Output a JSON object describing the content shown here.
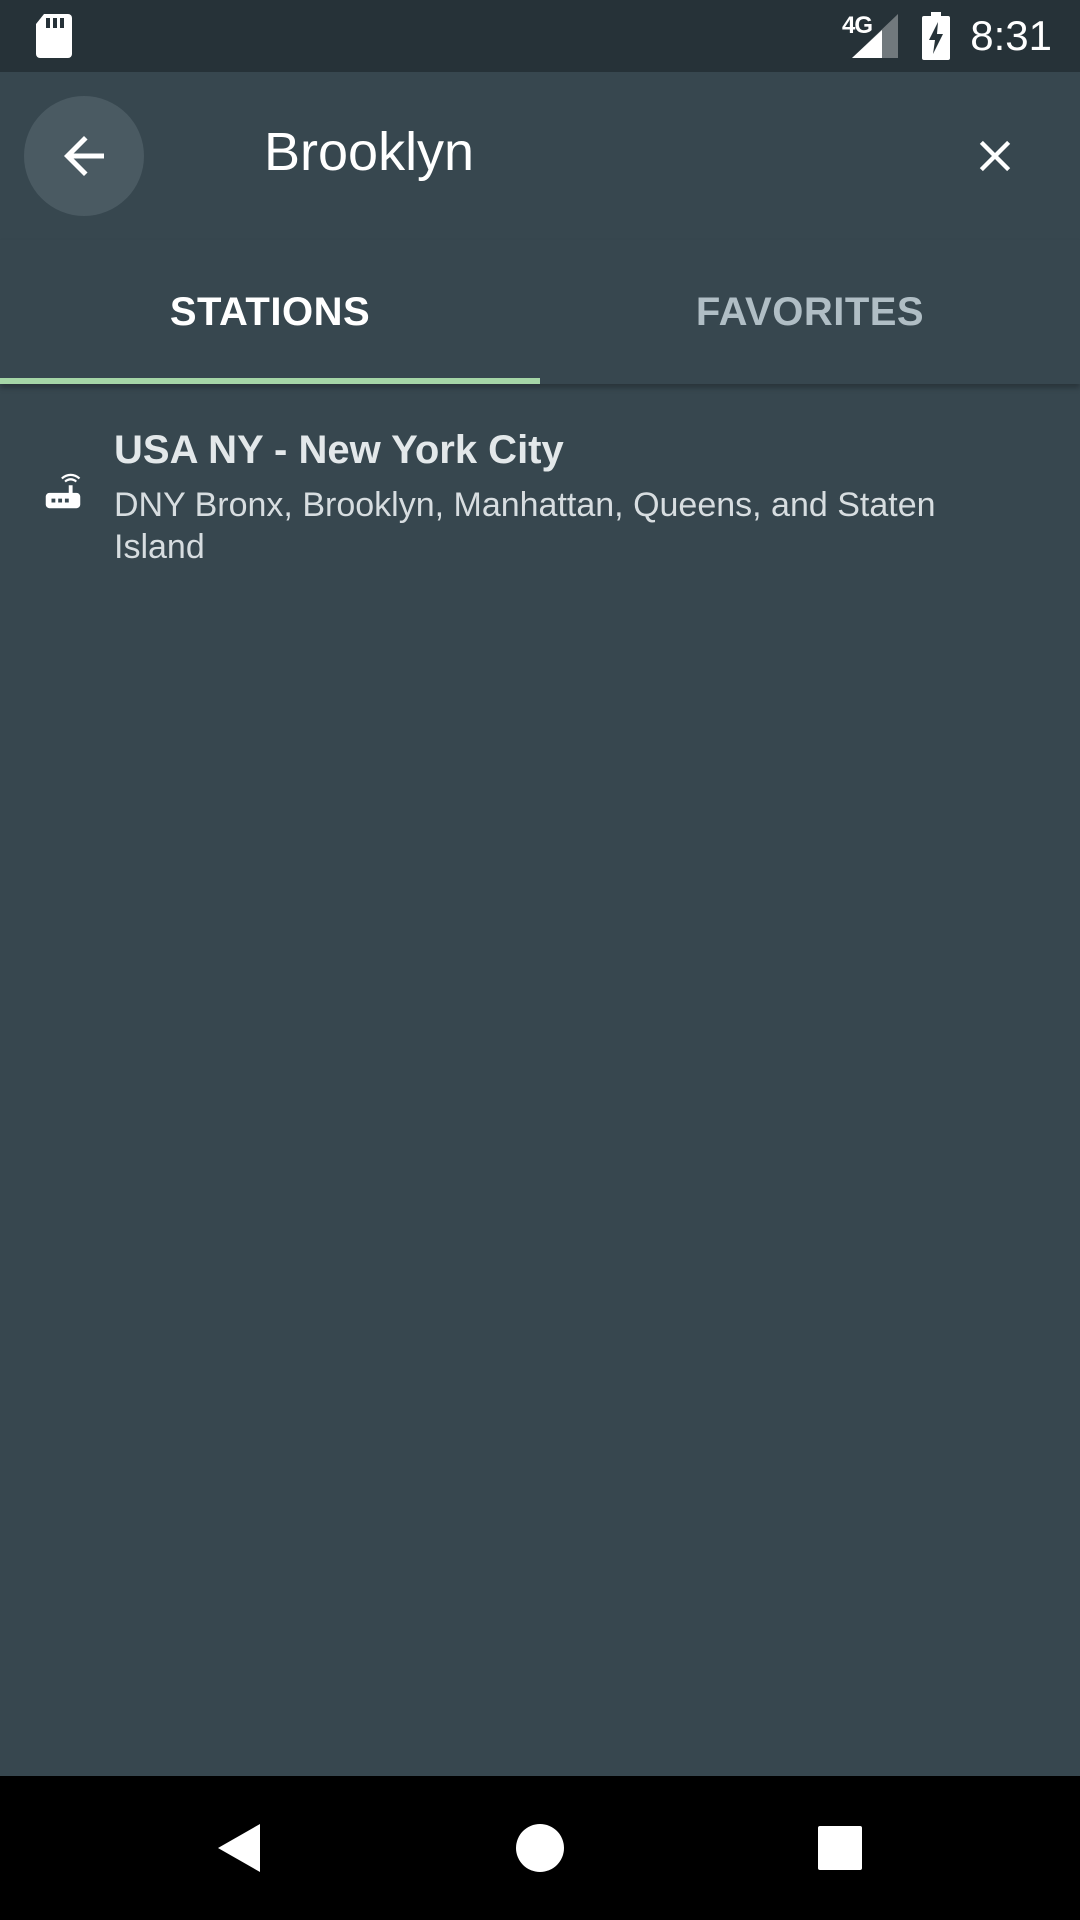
{
  "status_bar": {
    "network": "4G",
    "time": "8:31",
    "icons": [
      "sd-card-icon",
      "cell-signal-icon",
      "battery-charging-icon"
    ]
  },
  "search": {
    "query": "Brooklyn",
    "back_icon": "arrow-back-icon",
    "clear_icon": "close-icon"
  },
  "tabs": [
    {
      "label": "STATIONS",
      "selected": true
    },
    {
      "label": "FAVORITES",
      "selected": false
    }
  ],
  "results": [
    {
      "icon": "router-station-icon",
      "title": "USA NY - New York City",
      "subtitle": "DNY Bronx, Brooklyn, Manhattan, Queens, and Staten Island"
    }
  ],
  "nav_bar": {
    "icons": [
      "nav-back-icon",
      "nav-home-icon",
      "nav-recents-icon"
    ]
  },
  "colors": {
    "background": "#37474f",
    "status_bar": "#263238",
    "tab_indicator": "#a5d6a7",
    "back_button_bg": "#4a5a62"
  }
}
